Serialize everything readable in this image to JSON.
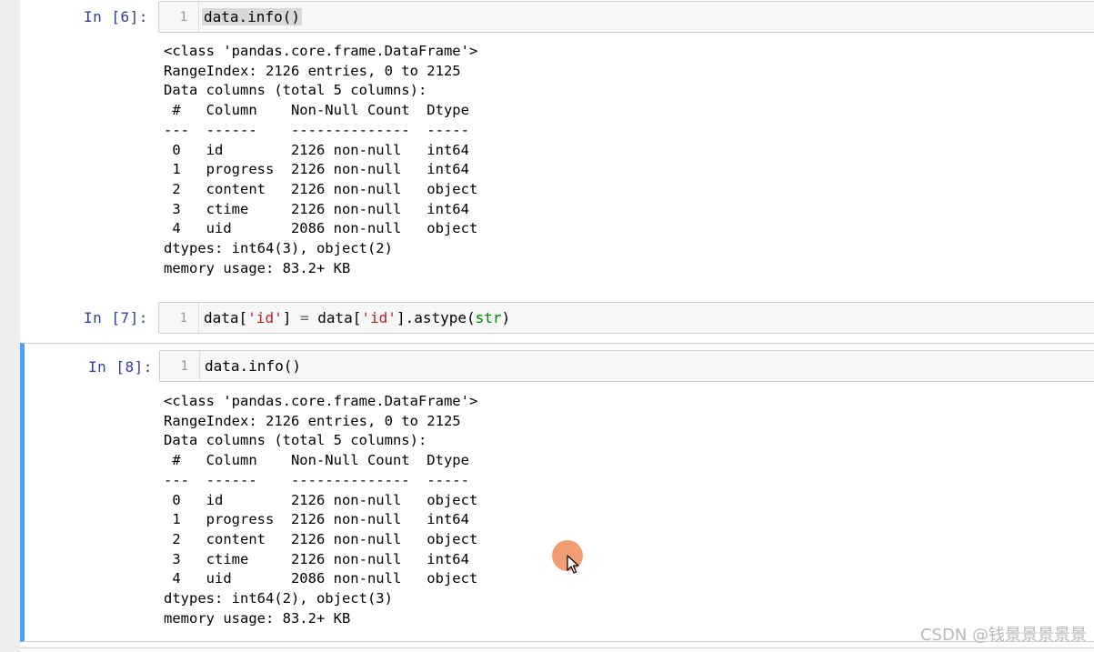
{
  "cells": [
    {
      "prompt": "In  [6]:",
      "line_number": "1",
      "code": "data.info()",
      "output": "<class 'pandas.core.frame.DataFrame'>\nRangeIndex: 2126 entries, 0 to 2125\nData columns (total 5 columns):\n #   Column    Non-Null Count  Dtype \n---  ------    --------------  ----- \n 0   id        2126 non-null   int64 \n 1   progress  2126 non-null   int64 \n 2   content   2126 non-null   object\n 3   ctime     2126 non-null   int64 \n 4   uid       2086 non-null   object\ndtypes: int64(3), object(2)\nmemory usage: 83.2+ KB"
    },
    {
      "prompt": "In  [7]:",
      "line_number": "1",
      "code_parts": {
        "a": "data[",
        "b": "'id'",
        "c": "] ",
        "d": "=",
        "e": " data[",
        "f": "'id'",
        "g": "].astype(",
        "h": "str",
        "i": ")"
      }
    },
    {
      "prompt": "In  [8]:",
      "line_number": "1",
      "code": "data.info()",
      "output": "<class 'pandas.core.frame.DataFrame'>\nRangeIndex: 2126 entries, 0 to 2125\nData columns (total 5 columns):\n #   Column    Non-Null Count  Dtype \n---  ------    --------------  ----- \n 0   id        2126 non-null   object\n 1   progress  2126 non-null   int64 \n 2   content   2126 non-null   object\n 3   ctime     2126 non-null   int64 \n 4   uid       2086 non-null   object\ndtypes: int64(2), object(3)\nmemory usage: 83.2+ KB"
    }
  ],
  "watermark": "CSDN @钱景景景景景",
  "colors": {
    "selection_bar": "#42a5f5",
    "prompt": "#303f9f",
    "string": "#ba2121",
    "builtin": "#008000",
    "cursor_highlight": "#f08c5a"
  },
  "icons": {
    "cursor": "mouse-pointer-icon"
  }
}
